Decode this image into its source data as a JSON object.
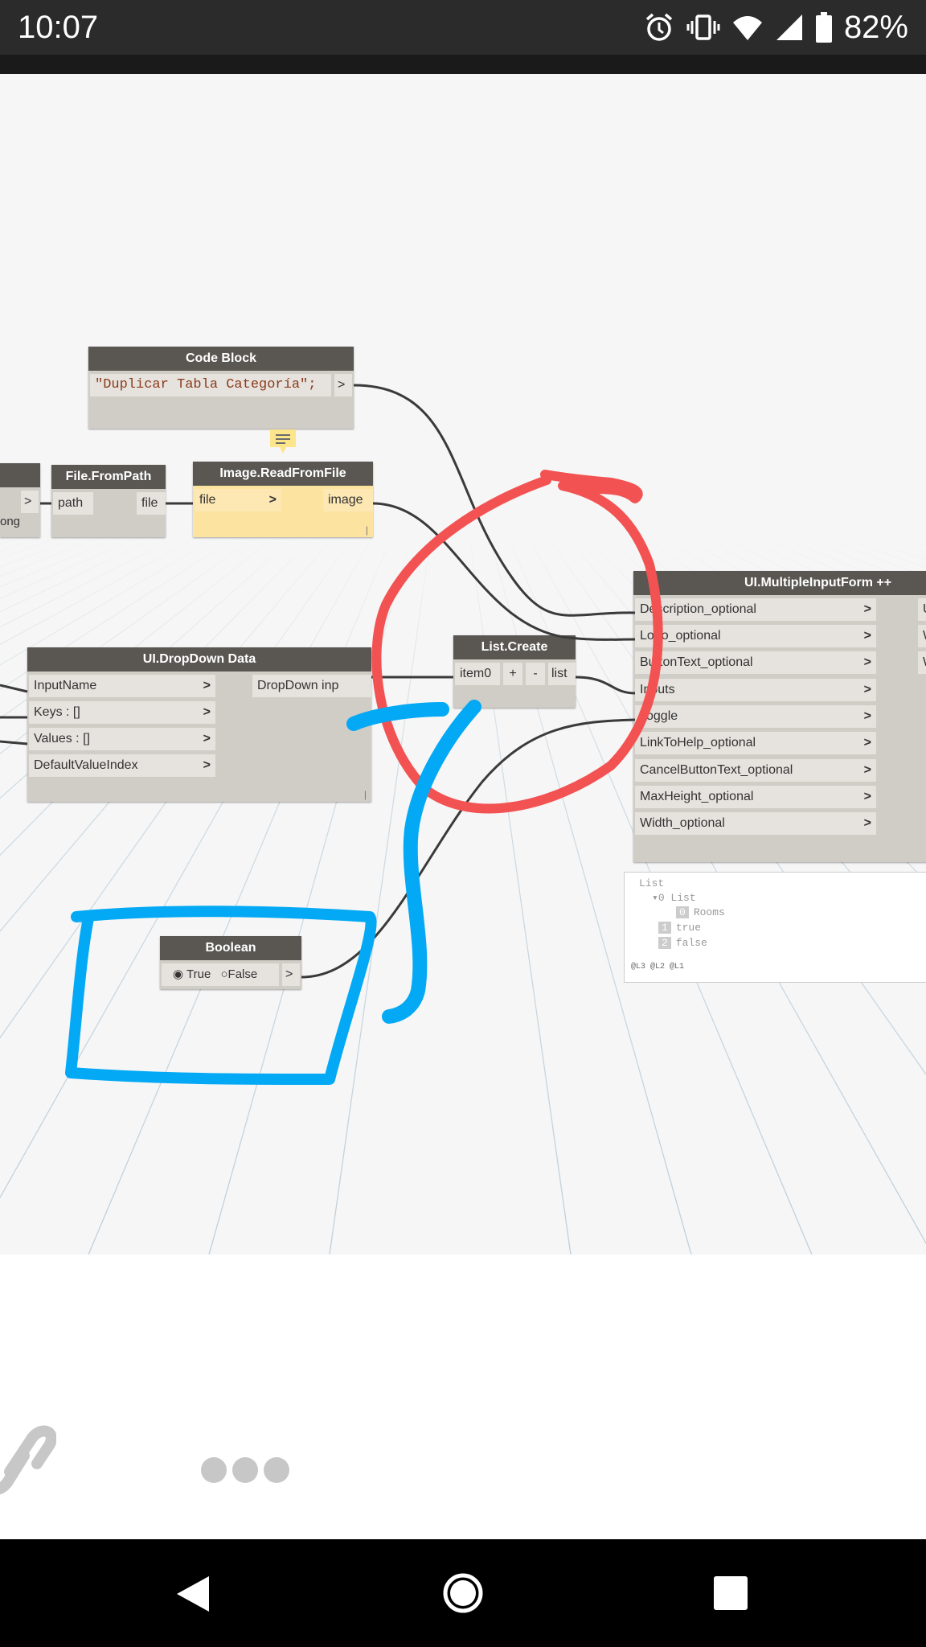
{
  "status_bar": {
    "time": "10:07",
    "battery": "82%"
  },
  "nodes": {
    "code_block": {
      "title": "Code Block",
      "code": "\"Duplicar Tabla Categoría\";",
      "out": ">"
    },
    "partial_left": {
      "out": ">",
      "text": "ong"
    },
    "file_from_path": {
      "title": "File.FromPath",
      "in": "path",
      "out": "file"
    },
    "image_read": {
      "title": "Image.ReadFromFile",
      "in": "file",
      "out": "image",
      "footer": "|"
    },
    "dropdown": {
      "title": "UI.DropDown Data",
      "inputs": [
        "InputName",
        "Keys : []",
        "Values : []",
        "DefaultValueIndex"
      ],
      "output": "DropDown inp",
      "footer": "|"
    },
    "list_create": {
      "title": "List.Create",
      "in": "item0",
      "plus": "+",
      "minus": "-",
      "out": "list"
    },
    "multi_form": {
      "title": "UI.MultipleInputForm ++",
      "inputs": [
        "Description_optional",
        "Logo_optional",
        "ButtonText_optional",
        "Inputs",
        "Toggle",
        "LinkToHelp_optional",
        "CancelButtonText_optional",
        "MaxHeight_optional",
        "Width_optional"
      ],
      "outputs": [
        "U",
        "W",
        "W"
      ]
    },
    "boolean": {
      "title": "Boolean",
      "opt_true": "True",
      "opt_false": "False",
      "out": ">"
    }
  },
  "watch": {
    "title": "List",
    "line0": "0 List",
    "items": [
      {
        "idx": "0",
        "text": "Rooms"
      },
      {
        "idx": "1",
        "text": "true"
      },
      {
        "idx": "2",
        "text": "false"
      }
    ],
    "footer": "@L3 @L2 @L1"
  },
  "colors": {
    "red_annotation": "#f35252",
    "blue_annotation": "#03a9f4",
    "node_header": "#5a5752",
    "node_body": "#d0ccc6",
    "image_node": "#fde3a0"
  },
  "icons": {
    "alarm": "alarm-icon",
    "vibrate": "vibrate-icon",
    "wifi": "wifi-icon",
    "signal": "signal-icon",
    "battery": "battery-icon",
    "link": "link-icon",
    "more": "more-icon",
    "back": "back-icon",
    "home": "home-icon",
    "recents": "recents-icon"
  }
}
